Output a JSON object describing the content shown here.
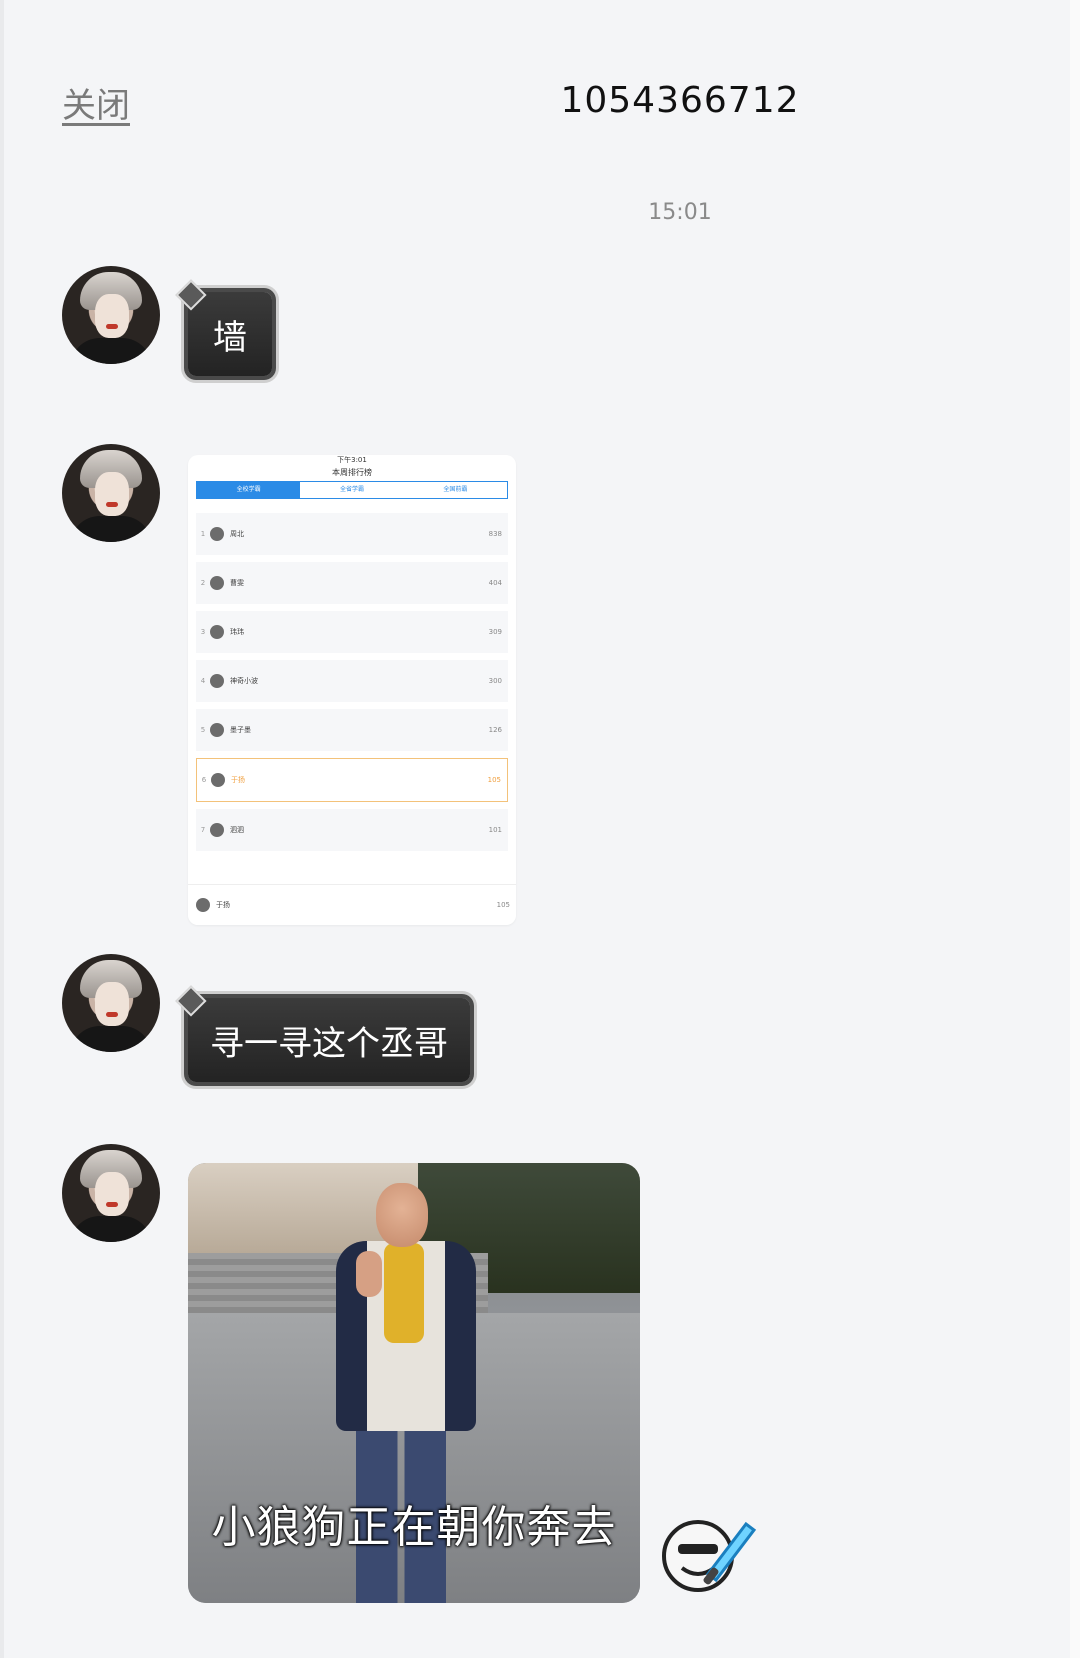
{
  "header": {
    "close_label": "关闭",
    "title": "1054366712"
  },
  "timestamp": "15:01",
  "messages": [
    {
      "type": "text",
      "text": "墙"
    },
    {
      "type": "image_screenshot",
      "screenshot": {
        "status": "下午3:01",
        "title": "本周排行榜",
        "tabs": [
          "全校学霸",
          "全省学霸",
          "全国前霸"
        ],
        "rows": [
          {
            "rank": "1",
            "name": "周北",
            "score": "838"
          },
          {
            "rank": "2",
            "name": "曹雯",
            "score": "404"
          },
          {
            "rank": "3",
            "name": "玮玮",
            "score": "309"
          },
          {
            "rank": "4",
            "name": "神奇小波",
            "score": "300"
          },
          {
            "rank": "5",
            "name": "墨子墨",
            "score": "126"
          },
          {
            "rank": "6",
            "name": "于扬",
            "score": "105"
          },
          {
            "rank": "7",
            "name": "泗泗",
            "score": "101"
          }
        ],
        "footer": {
          "name": "于扬",
          "score": "105"
        }
      }
    },
    {
      "type": "text",
      "text": "寻一寻这个丞哥"
    },
    {
      "type": "image_photo",
      "caption": "小狼狗正在朝你奔去"
    }
  ],
  "colors": {
    "background": "#f4f5f7",
    "bubble_dark": "#2a2a2a",
    "accent_blue": "#2b8be6",
    "highlight_orange": "#f0a040"
  },
  "icons": {
    "avatar": "avatar",
    "sticker": "sword-emoji-icon"
  }
}
